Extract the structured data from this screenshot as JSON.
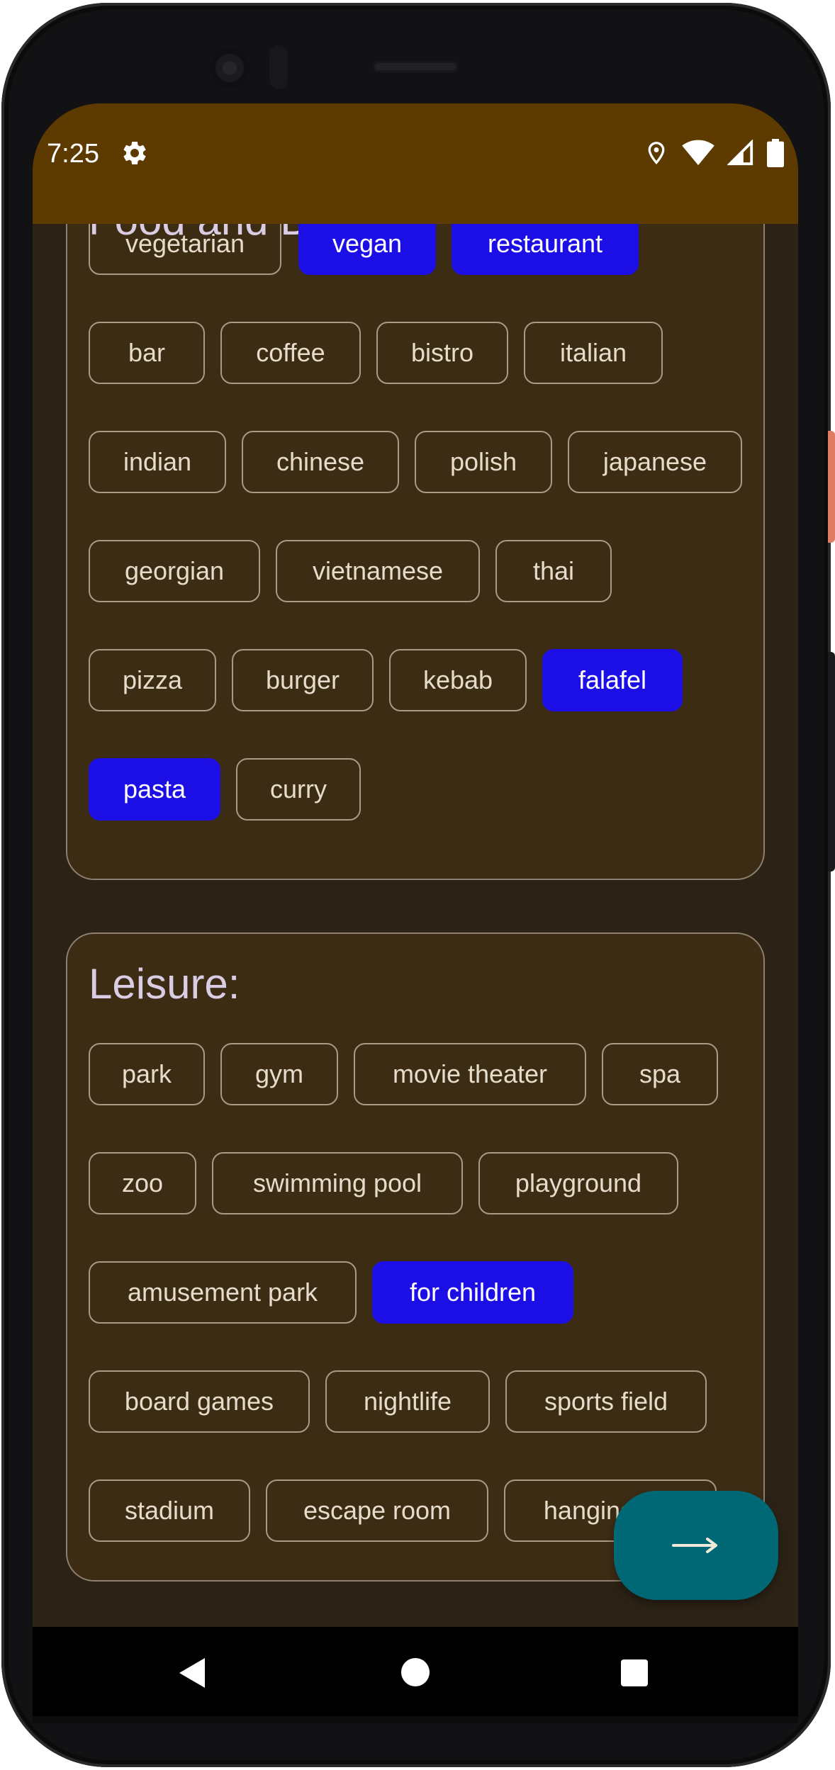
{
  "status_bar": {
    "time": "7:25",
    "background_color": "#5c3a00",
    "icons": [
      "settings-icon",
      "location-icon",
      "wifi-icon",
      "signal-icon",
      "battery-icon"
    ]
  },
  "food_section": {
    "title": "Food and Drinks:",
    "chips": [
      {
        "label": "vegetarian",
        "selected": false
      },
      {
        "label": "vegan",
        "selected": true
      },
      {
        "label": "restaurant",
        "selected": true
      },
      {
        "label": "bar",
        "selected": false
      },
      {
        "label": "coffee",
        "selected": false
      },
      {
        "label": "bistro",
        "selected": false
      },
      {
        "label": "italian",
        "selected": false
      },
      {
        "label": "indian",
        "selected": false
      },
      {
        "label": "chinese",
        "selected": false
      },
      {
        "label": "polish",
        "selected": false
      },
      {
        "label": "japanese",
        "selected": false
      },
      {
        "label": "georgian",
        "selected": false
      },
      {
        "label": "vietnamese",
        "selected": false
      },
      {
        "label": "thai",
        "selected": false
      },
      {
        "label": "pizza",
        "selected": false
      },
      {
        "label": "burger",
        "selected": false
      },
      {
        "label": "kebab",
        "selected": false
      },
      {
        "label": "falafel",
        "selected": true
      },
      {
        "label": "pasta",
        "selected": true
      },
      {
        "label": "curry",
        "selected": false
      }
    ]
  },
  "leisure_section": {
    "title": "Leisure:",
    "chips": [
      {
        "label": "park",
        "selected": false
      },
      {
        "label": "gym",
        "selected": false
      },
      {
        "label": "movie theater",
        "selected": false
      },
      {
        "label": "spa",
        "selected": false
      },
      {
        "label": "zoo",
        "selected": false
      },
      {
        "label": "swimming pool",
        "selected": false
      },
      {
        "label": "playground",
        "selected": false
      },
      {
        "label": "amusement park",
        "selected": false
      },
      {
        "label": "for children",
        "selected": true
      },
      {
        "label": "board games",
        "selected": false
      },
      {
        "label": "nightlife",
        "selected": false
      },
      {
        "label": "sports field",
        "selected": false
      },
      {
        "label": "stadium",
        "selected": false
      },
      {
        "label": "escape room",
        "selected": false
      },
      {
        "label": "hanging out",
        "selected": false
      }
    ]
  },
  "fab": {
    "icon": "arrow-right-icon",
    "color": "#006874"
  },
  "nav_bar": {
    "icons": [
      "back-icon",
      "home-icon",
      "recents-icon"
    ]
  },
  "colors": {
    "chip_selected": "#1c0fe6",
    "card_background": "#3d2c14",
    "screen_background": "#2c2316"
  }
}
